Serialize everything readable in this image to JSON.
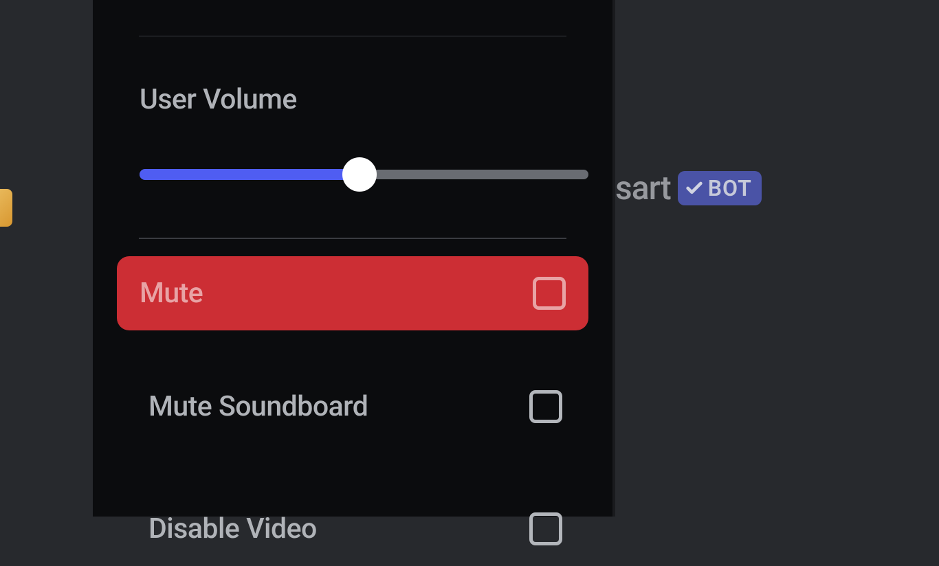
{
  "menu": {
    "volume": {
      "label": "User Volume",
      "value_percent": 49
    },
    "items": [
      {
        "label": "Mute",
        "checked": false,
        "highlighted": true
      },
      {
        "label": "Mute Soundboard",
        "checked": false,
        "highlighted": false
      },
      {
        "label": "Disable Video",
        "checked": false,
        "highlighted": false
      }
    ]
  },
  "background": {
    "username_partial": "sart",
    "badge_text": "BOT"
  }
}
